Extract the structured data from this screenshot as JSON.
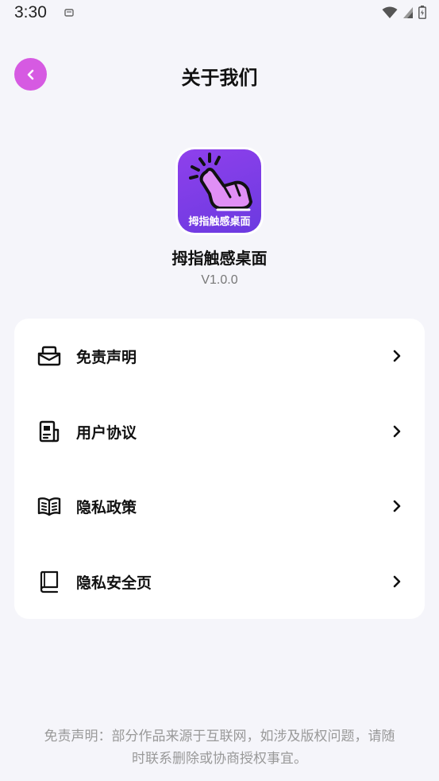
{
  "status_bar": {
    "time": "3:30"
  },
  "header": {
    "title": "关于我们"
  },
  "app": {
    "icon_caption": "拇指触感桌面",
    "name": "拇指触感桌面",
    "version": "V1.0.0"
  },
  "menu": {
    "items": [
      {
        "label": "免责声明",
        "icon": "envelope-icon"
      },
      {
        "label": "用户协议",
        "icon": "document-icon"
      },
      {
        "label": "隐私政策",
        "icon": "open-book-icon"
      },
      {
        "label": "隐私安全页",
        "icon": "book-icon"
      }
    ]
  },
  "footer": {
    "disclaimer": "免责声明：部分作品来源于互联网，如涉及版权问题，请随时联系删除或协商授权事宜。"
  },
  "colors": {
    "accent": "#d65ae2",
    "background": "#f5f5fa",
    "card": "#ffffff",
    "icon_purple": "#7a3de6"
  }
}
